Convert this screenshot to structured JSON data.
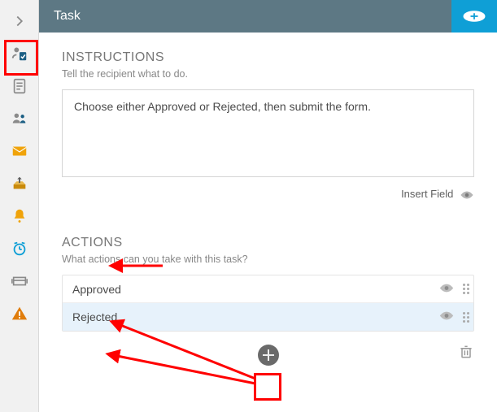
{
  "header": {
    "title": "Task"
  },
  "instructions": {
    "heading": "INSTRUCTIONS",
    "sub": "Tell the recipient what to do.",
    "value": "Choose either Approved or Rejected, then submit the form.",
    "insert_label": "Insert Field"
  },
  "actions": {
    "heading": "ACTIONS",
    "sub": "What actions can you take with this task?",
    "items": [
      {
        "label": "Approved",
        "selected": false
      },
      {
        "label": "Rejected",
        "selected": true
      }
    ]
  },
  "colors": {
    "headerBg": "#5d7884",
    "accent": "#0f9fd6",
    "annotation": "#ff0000"
  }
}
